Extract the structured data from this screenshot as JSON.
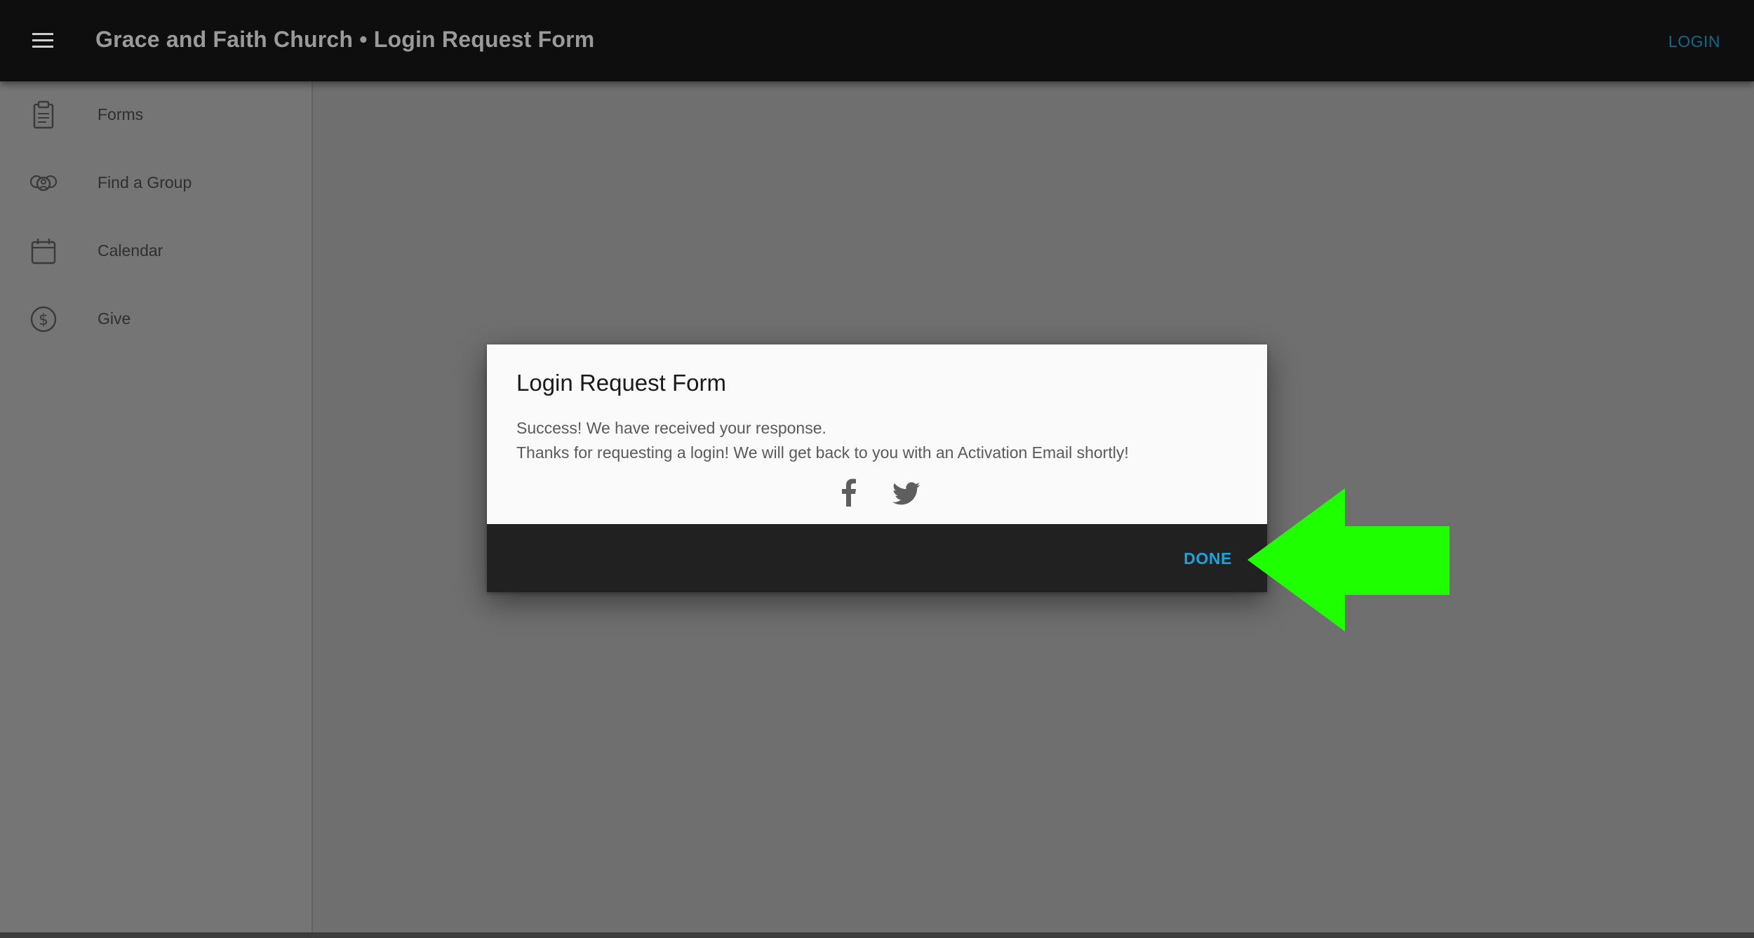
{
  "header": {
    "menu_icon": "hamburger-icon",
    "title": "Grace and Faith Church • Login Request Form",
    "login_label": "LOGIN"
  },
  "sidebar": {
    "items": [
      {
        "label": "Forms",
        "icon": "clipboard-icon"
      },
      {
        "label": "Find a Group",
        "icon": "group-icon"
      },
      {
        "label": "Calendar",
        "icon": "calendar-icon"
      },
      {
        "label": "Give",
        "icon": "dollar-circle-icon"
      }
    ]
  },
  "dialog": {
    "title": "Login Request Form",
    "line1": "Success! We have received your response.",
    "line2": "Thanks for requesting a login! We will get back to you with an Activation Email shortly!",
    "share_icons": [
      "facebook-icon",
      "twitter-icon"
    ],
    "done_label": "DONE"
  },
  "colors": {
    "topbar": "#0e0e0e",
    "accent": "#1aa3dd",
    "annotation_arrow": "#1eff00"
  }
}
